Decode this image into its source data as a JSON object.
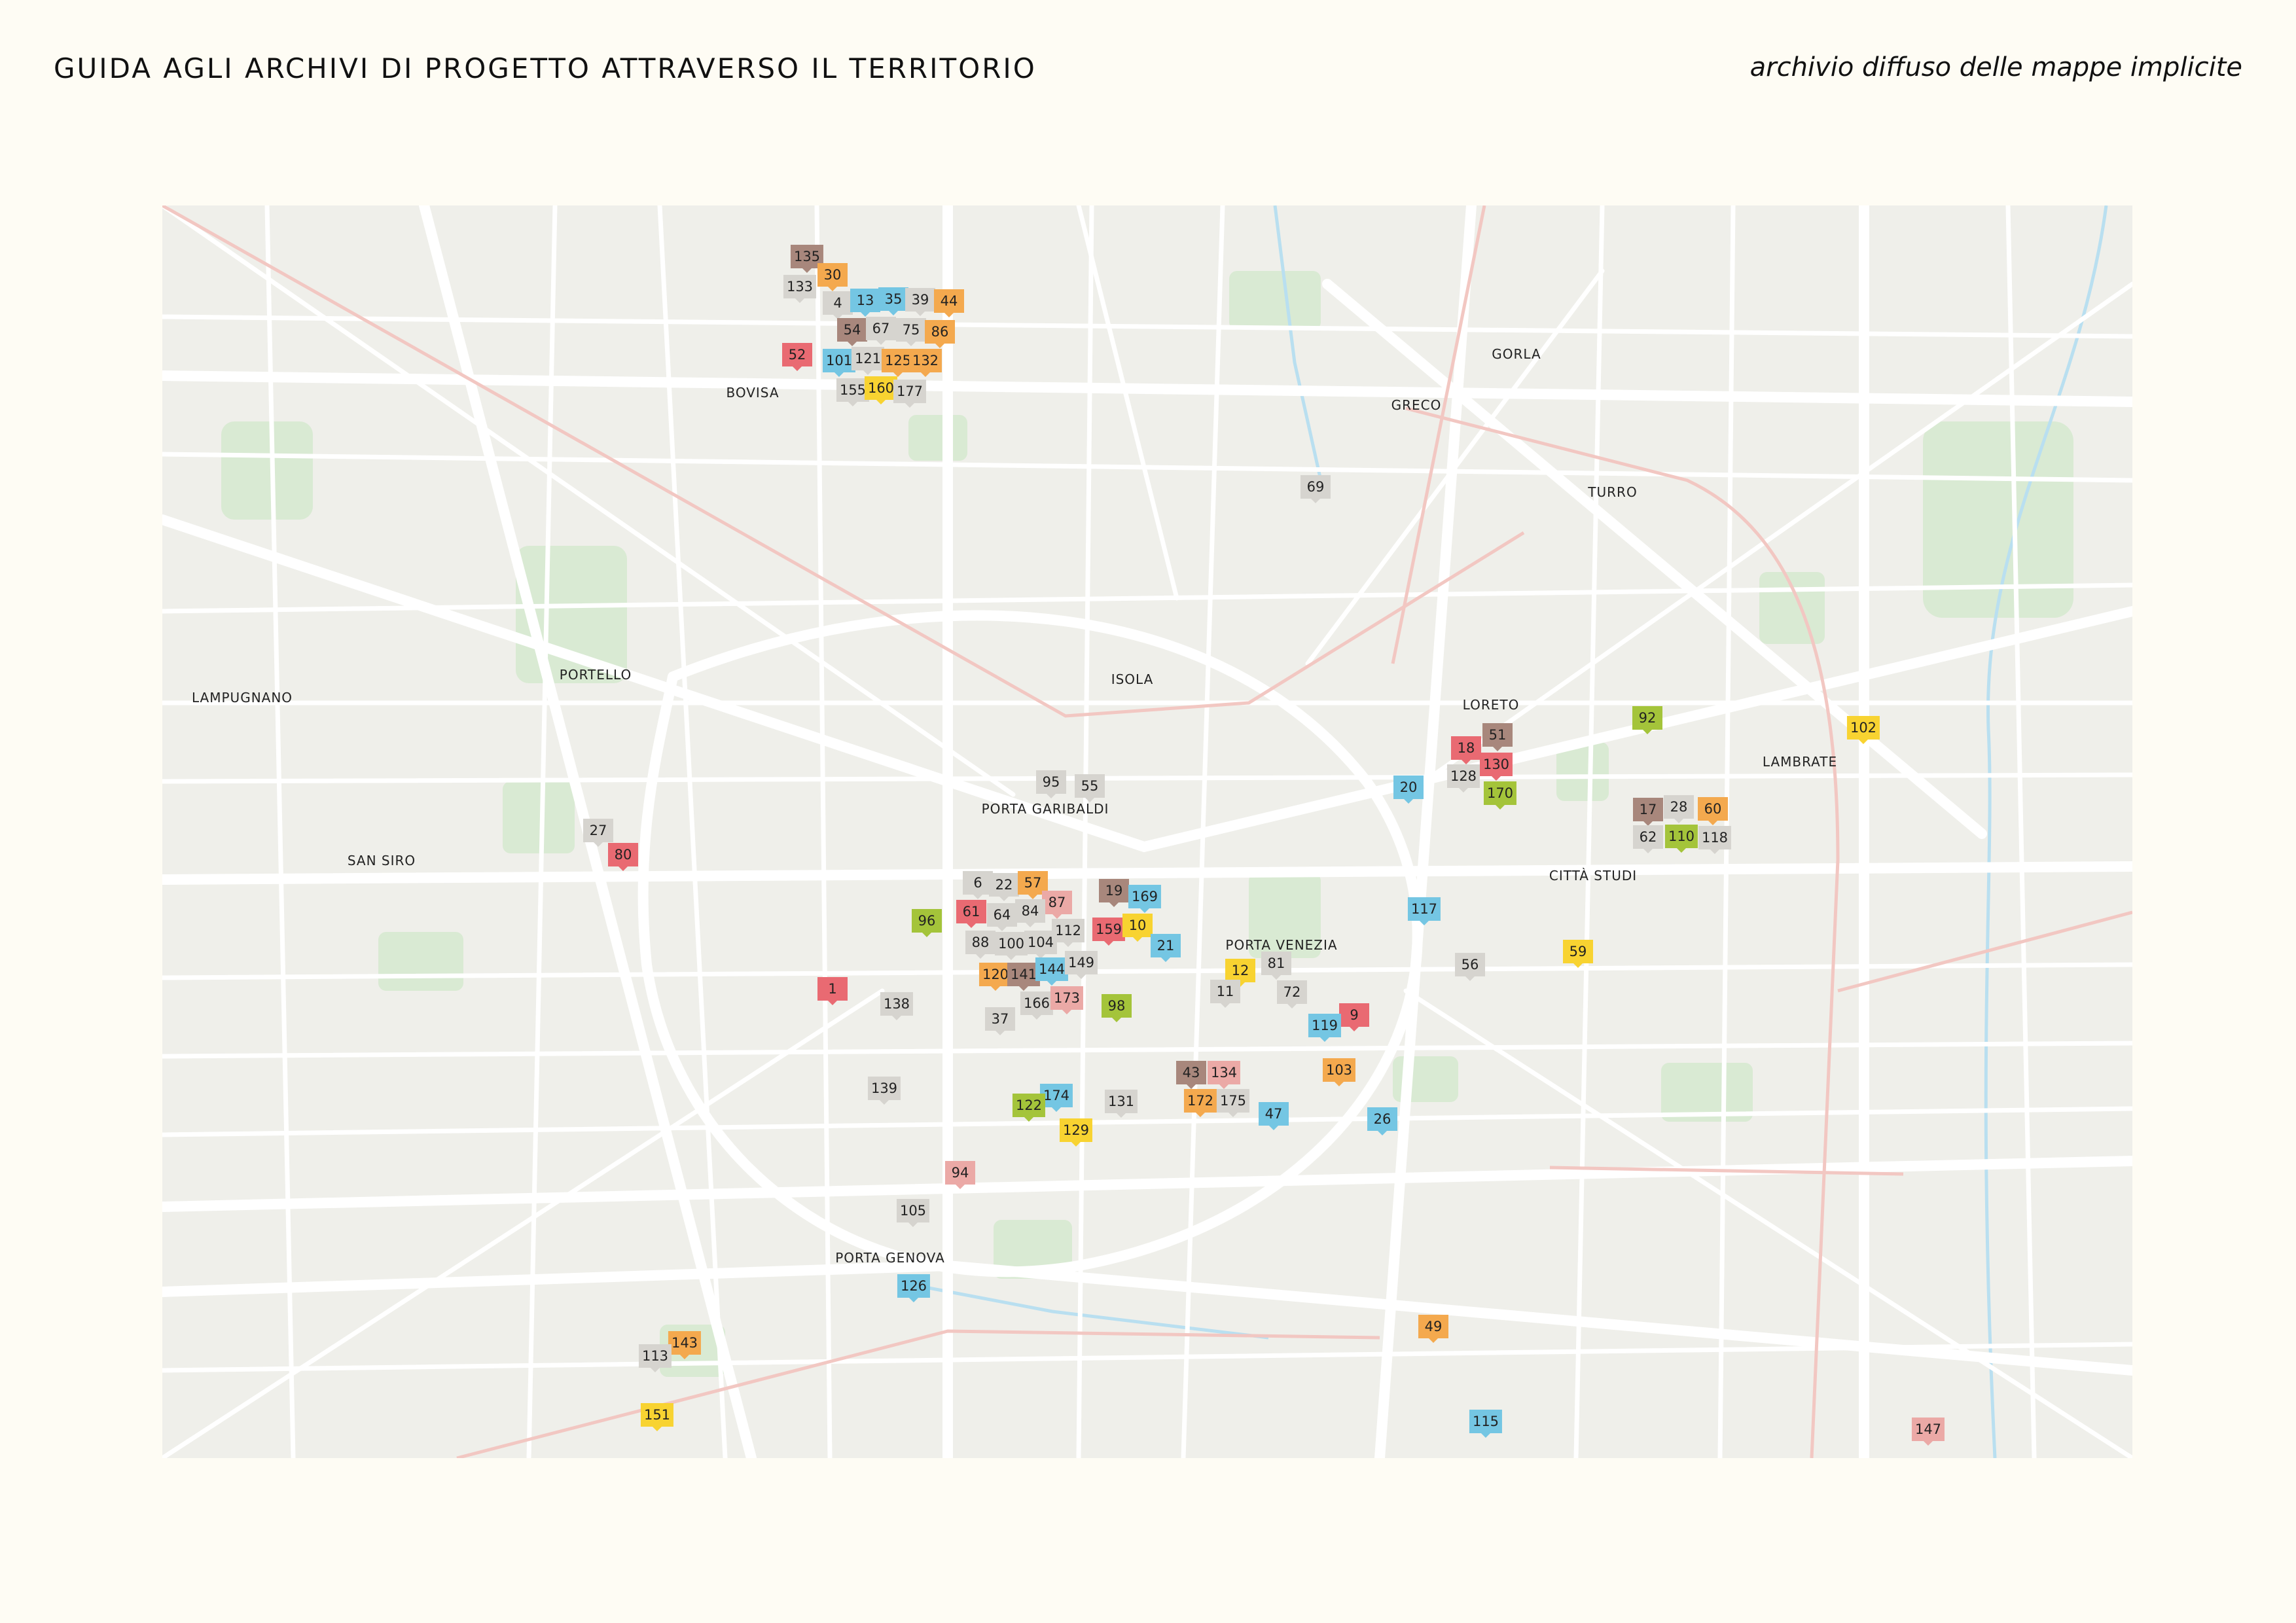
{
  "header": {
    "title": "GUIDA AGLI ARCHIVI DI PROGETTO ATTRAVERSO IL TERRITORIO",
    "subtitle": "archivio diffuso delle mappe implicite"
  },
  "colors": {
    "background": "#fefcf4",
    "map_base": "#efefea",
    "road": "#ffffff",
    "park": "#d9ead3",
    "rail": "#f2c7c2",
    "water": "#b9dff0",
    "categories": {
      "red": "#e96a72",
      "orange": "#f4a94e",
      "yellow": "#f8d331",
      "blue": "#74c6e3",
      "green": "#a4c43a",
      "brown": "#a8877c",
      "pink": "#eba9a6",
      "grey": "#d6d4cf"
    }
  },
  "districts": [
    "BOVISA",
    "GORLA",
    "GRECO",
    "TURRO",
    "ISOLA",
    "LORETO",
    "LAMPUGNANO",
    "PORTELLO",
    "PORTA GARIBALDI",
    "LAMBRATE",
    "SAN SIRO",
    "CITTÀ STUDI",
    "PORTA VENEZIA",
    "PORTA GENOVA"
  ],
  "markers": [
    {
      "label": "135",
      "cat": "brown"
    },
    {
      "label": "30",
      "cat": "orange"
    },
    {
      "label": "133",
      "cat": "grey"
    },
    {
      "label": "4",
      "cat": "grey"
    },
    {
      "label": "13",
      "cat": "blue"
    },
    {
      "label": "35",
      "cat": "blue"
    },
    {
      "label": "39",
      "cat": "grey"
    },
    {
      "label": "44",
      "cat": "orange"
    },
    {
      "label": "54",
      "cat": "brown"
    },
    {
      "label": "67",
      "cat": "grey"
    },
    {
      "label": "75",
      "cat": "grey"
    },
    {
      "label": "86",
      "cat": "orange"
    },
    {
      "label": "52",
      "cat": "red"
    },
    {
      "label": "101",
      "cat": "blue"
    },
    {
      "label": "121",
      "cat": "grey"
    },
    {
      "label": "125",
      "cat": "orange"
    },
    {
      "label": "132",
      "cat": "orange"
    },
    {
      "label": "155",
      "cat": "grey"
    },
    {
      "label": "160",
      "cat": "yellow"
    },
    {
      "label": "177",
      "cat": "grey"
    },
    {
      "label": "69",
      "cat": "grey"
    },
    {
      "label": "92",
      "cat": "green"
    },
    {
      "label": "102",
      "cat": "yellow"
    },
    {
      "label": "51",
      "cat": "brown"
    },
    {
      "label": "18",
      "cat": "red"
    },
    {
      "label": "130",
      "cat": "red"
    },
    {
      "label": "128",
      "cat": "grey"
    },
    {
      "label": "170",
      "cat": "green"
    },
    {
      "label": "20",
      "cat": "blue"
    },
    {
      "label": "17",
      "cat": "brown"
    },
    {
      "label": "28",
      "cat": "grey"
    },
    {
      "label": "60",
      "cat": "orange"
    },
    {
      "label": "62",
      "cat": "grey"
    },
    {
      "label": "110",
      "cat": "green"
    },
    {
      "label": "118",
      "cat": "grey"
    },
    {
      "label": "95",
      "cat": "grey"
    },
    {
      "label": "55",
      "cat": "grey"
    },
    {
      "label": "27",
      "cat": "grey"
    },
    {
      "label": "80",
      "cat": "red"
    },
    {
      "label": "6",
      "cat": "grey"
    },
    {
      "label": "22",
      "cat": "grey"
    },
    {
      "label": "57",
      "cat": "orange"
    },
    {
      "label": "87",
      "cat": "pink"
    },
    {
      "label": "19",
      "cat": "brown"
    },
    {
      "label": "169",
      "cat": "blue"
    },
    {
      "label": "96",
      "cat": "green"
    },
    {
      "label": "61",
      "cat": "red"
    },
    {
      "label": "64",
      "cat": "grey"
    },
    {
      "label": "84",
      "cat": "grey"
    },
    {
      "label": "112",
      "cat": "grey"
    },
    {
      "label": "159",
      "cat": "red"
    },
    {
      "label": "10",
      "cat": "yellow"
    },
    {
      "label": "88",
      "cat": "grey"
    },
    {
      "label": "100",
      "cat": "grey"
    },
    {
      "label": "104",
      "cat": "grey"
    },
    {
      "label": "21",
      "cat": "blue"
    },
    {
      "label": "117",
      "cat": "blue"
    },
    {
      "label": "56",
      "cat": "grey"
    },
    {
      "label": "59",
      "cat": "yellow"
    },
    {
      "label": "120",
      "cat": "orange"
    },
    {
      "label": "141",
      "cat": "brown"
    },
    {
      "label": "144",
      "cat": "blue"
    },
    {
      "label": "149",
      "cat": "grey"
    },
    {
      "label": "12",
      "cat": "yellow"
    },
    {
      "label": "81",
      "cat": "grey"
    },
    {
      "label": "11",
      "cat": "grey"
    },
    {
      "label": "72",
      "cat": "grey"
    },
    {
      "label": "1",
      "cat": "red"
    },
    {
      "label": "138",
      "cat": "grey"
    },
    {
      "label": "166",
      "cat": "grey"
    },
    {
      "label": "173",
      "cat": "pink"
    },
    {
      "label": "98",
      "cat": "green"
    },
    {
      "label": "37",
      "cat": "grey"
    },
    {
      "label": "9",
      "cat": "red"
    },
    {
      "label": "119",
      "cat": "blue"
    },
    {
      "label": "43",
      "cat": "brown"
    },
    {
      "label": "134",
      "cat": "pink"
    },
    {
      "label": "103",
      "cat": "orange"
    },
    {
      "label": "139",
      "cat": "grey"
    },
    {
      "label": "174",
      "cat": "blue"
    },
    {
      "label": "122",
      "cat": "green"
    },
    {
      "label": "131",
      "cat": "grey"
    },
    {
      "label": "172",
      "cat": "orange"
    },
    {
      "label": "175",
      "cat": "grey"
    },
    {
      "label": "47",
      "cat": "blue"
    },
    {
      "label": "26",
      "cat": "blue"
    },
    {
      "label": "129",
      "cat": "yellow"
    },
    {
      "label": "94",
      "cat": "pink"
    },
    {
      "label": "105",
      "cat": "grey"
    },
    {
      "label": "126",
      "cat": "blue"
    },
    {
      "label": "49",
      "cat": "orange"
    },
    {
      "label": "143",
      "cat": "orange"
    },
    {
      "label": "113",
      "cat": "grey"
    },
    {
      "label": "151",
      "cat": "yellow"
    },
    {
      "label": "115",
      "cat": "blue"
    },
    {
      "label": "147",
      "cat": "pink"
    }
  ]
}
